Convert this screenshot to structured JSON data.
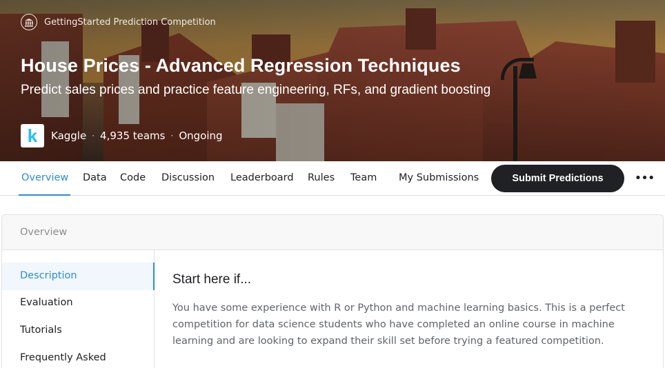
{
  "hero": {
    "competition_type": "GettingStarted Prediction Competition",
    "title": "House Prices - Advanced Regression Techniques",
    "subtitle": "Predict sales prices and practice feature engineering, RFs, and gradient boosting",
    "host_logo_letter": "k",
    "host": "Kaggle",
    "teams": "4,935 teams",
    "status": "Ongoing",
    "separator": "·"
  },
  "tabs": {
    "items": [
      "Overview",
      "Data",
      "Code",
      "Discussion",
      "Leaderboard",
      "Rules",
      "Team",
      "My Submissions"
    ],
    "active": "Overview",
    "submit_label": "Submit Predictions",
    "more_label": "•••"
  },
  "overview": {
    "header": "Overview",
    "sidebar": [
      "Description",
      "Evaluation",
      "Tutorials",
      "Frequently Asked"
    ],
    "active_item": "Description",
    "heading": "Start here if...",
    "body": "You have some experience with R or Python and machine learning basics. This is a perfect competition for data science students who have completed an online course in machine learning and are looking to expand their skill set before trying a featured competition."
  },
  "colors": {
    "accent": "#2a8bd8",
    "submit_button": "#202124",
    "kaggle_blue": "#20beff"
  },
  "icons": {
    "competition_type": "bank-icon",
    "more": "more-horizontal-icon"
  }
}
